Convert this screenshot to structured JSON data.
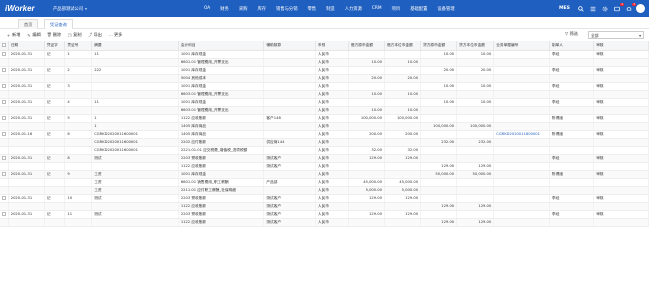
{
  "header": {
    "logo": "iWorker",
    "company": "产品部测试公司",
    "nav": [
      "OA",
      "财务",
      "采购",
      "库存",
      "销售与分销",
      "零售",
      "制造",
      "人力资源",
      "CRM",
      "项目",
      "基础配置",
      "设备管理"
    ],
    "mes": "MES",
    "badges": {
      "messages": "2",
      "notify": "3"
    },
    "colors": {
      "primary": "#1f5fbf",
      "badge": "#f5222d"
    }
  },
  "tabs": [
    "首页",
    "凭证查询"
  ],
  "toolbar": {
    "buttons": [
      "新增",
      "编辑",
      "删除",
      "复制",
      "导出",
      "更多"
    ],
    "filter_label": "筛选",
    "select_value": "全部"
  },
  "table": {
    "columns": [
      "日期",
      "凭证字",
      "凭证号",
      "摘要",
      "会计科目",
      "辅助核算",
      "币别",
      "借方原币金额",
      "借方本位币金额",
      "贷方原币金额",
      "贷方本位币金额",
      "业务单据编号",
      "制单人",
      "审核"
    ],
    "rows": [
      {
        "date": "2020-01-31",
        "word": "记",
        "no": "1",
        "summary": "11",
        "account": "1001 库存现金",
        "aux": "",
        "cur": "人民币",
        "dr_o": "",
        "dr_b": "",
        "cr_o": "10.00",
        "cr_b": "10.00",
        "doc": "",
        "maker": "李经",
        "aud": "审核"
      },
      {
        "date": "",
        "word": "",
        "no": "",
        "summary": "",
        "account": "6601.01 管理费用_开票支出",
        "aux": "",
        "cur": "人民币",
        "dr_o": "10.00",
        "dr_b": "10.00",
        "cr_o": "",
        "cr_b": "",
        "doc": "",
        "maker": "",
        "aud": ""
      },
      {
        "date": "2020-01-31",
        "word": "记",
        "no": "2",
        "summary": "222",
        "account": "1001 库存现金",
        "aux": "",
        "cur": "人民币",
        "dr_o": "",
        "dr_b": "",
        "cr_o": "20.00",
        "cr_b": "20.00",
        "doc": "",
        "maker": "李经",
        "aud": "审核"
      },
      {
        "date": "",
        "word": "",
        "no": "",
        "summary": "",
        "account": "5004 其他成本",
        "aux": "",
        "cur": "人民币",
        "dr_o": "20.00",
        "dr_b": "20.00",
        "cr_o": "",
        "cr_b": "",
        "doc": "",
        "maker": "",
        "aud": ""
      },
      {
        "date": "2020-01-31",
        "word": "记",
        "no": "3",
        "summary": "",
        "account": "1001 库存现金",
        "aux": "",
        "cur": "人民币",
        "dr_o": "",
        "dr_b": "",
        "cr_o": "10.00",
        "cr_b": "10.00",
        "doc": "",
        "maker": "李经",
        "aud": "审核"
      },
      {
        "date": "",
        "word": "",
        "no": "",
        "summary": "",
        "account": "6603.01 管理费用_开票支出",
        "aux": "",
        "cur": "人民币",
        "dr_o": "10.00",
        "dr_b": "10.00",
        "cr_o": "",
        "cr_b": "",
        "doc": "",
        "maker": "",
        "aud": ""
      },
      {
        "date": "2020-01-31",
        "word": "记",
        "no": "4",
        "summary": "11",
        "account": "1001 库存现金",
        "aux": "",
        "cur": "人民币",
        "dr_o": "",
        "dr_b": "",
        "cr_o": "10.00",
        "cr_b": "10.00",
        "doc": "",
        "maker": "李经",
        "aud": "审核"
      },
      {
        "date": "",
        "word": "",
        "no": "",
        "summary": "",
        "account": "6603.01 管理费用_开票支出",
        "aux": "",
        "cur": "人民币",
        "dr_o": "10.00",
        "dr_b": "10.00",
        "cr_o": "",
        "cr_b": "",
        "doc": "",
        "maker": "",
        "aud": ""
      },
      {
        "date": "2020-01-31",
        "word": "记",
        "no": "5",
        "summary": "1",
        "account": "1122 应收账款",
        "aux": "客户148",
        "cur": "人民币",
        "dr_o": "100,000.00",
        "dr_b": "100,000.00",
        "cr_o": "",
        "cr_b": "",
        "doc": "",
        "maker": "陈博绪",
        "aud": "审核"
      },
      {
        "date": "",
        "word": "",
        "no": "",
        "summary": "1",
        "account": "1405 库存商品",
        "aux": "",
        "cur": "人民币",
        "dr_o": "",
        "dr_b": "",
        "cr_o": "100,000.00",
        "cr_b": "100,000.00",
        "doc": "",
        "maker": "",
        "aud": ""
      },
      {
        "date": "2020-01-16",
        "word": "记",
        "no": "6",
        "summary": "CGRKD2020011600001",
        "account": "1405 库存商品",
        "aux": "",
        "cur": "人民币",
        "dr_o": "200.00",
        "dr_b": "200.00",
        "cr_o": "",
        "cr_b": "",
        "doc": "CGRKD2020011600001",
        "maker": "陈博绪",
        "aud": "审核"
      },
      {
        "date": "",
        "word": "",
        "no": "",
        "summary": "CGRKD2020011600001",
        "account": "2202 应付账款",
        "aux": "供应商144",
        "cur": "人民币",
        "dr_o": "",
        "dr_b": "",
        "cr_o": "232.00",
        "cr_b": "232.00",
        "doc": "",
        "maker": "",
        "aud": ""
      },
      {
        "date": "",
        "word": "",
        "no": "",
        "summary": "CGRKD2020011600001",
        "account": "2221.01.01 应交税费_增值税_进项税额",
        "aux": "",
        "cur": "人民币",
        "dr_o": "32.00",
        "dr_b": "32.00",
        "cr_o": "",
        "cr_b": "",
        "doc": "",
        "maker": "",
        "aud": ""
      },
      {
        "date": "2020-01-31",
        "word": "记",
        "no": "8",
        "summary": "测试",
        "account": "2203 预收账款",
        "aux": "测试客户",
        "cur": "人民币",
        "dr_o": "129.00",
        "dr_b": "129.00",
        "cr_o": "",
        "cr_b": "",
        "doc": "",
        "maker": "李经",
        "aud": "审核"
      },
      {
        "date": "",
        "word": "",
        "no": "",
        "summary": "",
        "account": "1122 应收账款",
        "aux": "测试客户",
        "cur": "人民币",
        "dr_o": "",
        "dr_b": "",
        "cr_o": "129.00",
        "cr_b": "129.00",
        "doc": "",
        "maker": "",
        "aud": ""
      },
      {
        "date": "2020-01-31",
        "word": "记",
        "no": "9",
        "summary": "工资",
        "account": "1001 库存现金",
        "aux": "",
        "cur": "人民币",
        "dr_o": "",
        "dr_b": "",
        "cr_o": "50,000.00",
        "cr_b": "50,000.00",
        "doc": "",
        "maker": "陈博绪",
        "aud": "审核"
      },
      {
        "date": "",
        "word": "",
        "no": "",
        "summary": "工资",
        "account": "6601.01 销售费用_职工薪酬",
        "aux": "产品部",
        "cur": "人民币",
        "dr_o": "45,000.00",
        "dr_b": "45,000.00",
        "cr_o": "",
        "cr_b": "",
        "doc": "",
        "maker": "",
        "aud": ""
      },
      {
        "date": "",
        "word": "",
        "no": "",
        "summary": "工资",
        "account": "2211.01 应付职工薪酬_社保明细",
        "aux": "",
        "cur": "人民币",
        "dr_o": "5,000.00",
        "dr_b": "5,000.00",
        "cr_o": "",
        "cr_b": "",
        "doc": "",
        "maker": "",
        "aud": ""
      },
      {
        "date": "2020-01-31",
        "word": "记",
        "no": "10",
        "summary": "测试",
        "account": "2203 预收账款",
        "aux": "测试客户",
        "cur": "人民币",
        "dr_o": "129.00",
        "dr_b": "129.00",
        "cr_o": "",
        "cr_b": "",
        "doc": "",
        "maker": "李经",
        "aud": "审核"
      },
      {
        "date": "",
        "word": "",
        "no": "",
        "summary": "",
        "account": "1122 应收账款",
        "aux": "测试客户",
        "cur": "人民币",
        "dr_o": "",
        "dr_b": "",
        "cr_o": "129.00",
        "cr_b": "129.00",
        "doc": "",
        "maker": "",
        "aud": ""
      },
      {
        "date": "2020-01-31",
        "word": "记",
        "no": "11",
        "summary": "测试",
        "account": "2203 预收账款",
        "aux": "测试客户",
        "cur": "人民币",
        "dr_o": "129.00",
        "dr_b": "129.00",
        "cr_o": "",
        "cr_b": "",
        "doc": "",
        "maker": "李经",
        "aud": "审核"
      },
      {
        "date": "",
        "word": "",
        "no": "",
        "summary": "",
        "account": "1122 应收账款",
        "aux": "测试客户",
        "cur": "人民币",
        "dr_o": "",
        "dr_b": "",
        "cr_o": "129.00",
        "cr_b": "129.00",
        "doc": "",
        "maker": "",
        "aud": ""
      }
    ]
  }
}
